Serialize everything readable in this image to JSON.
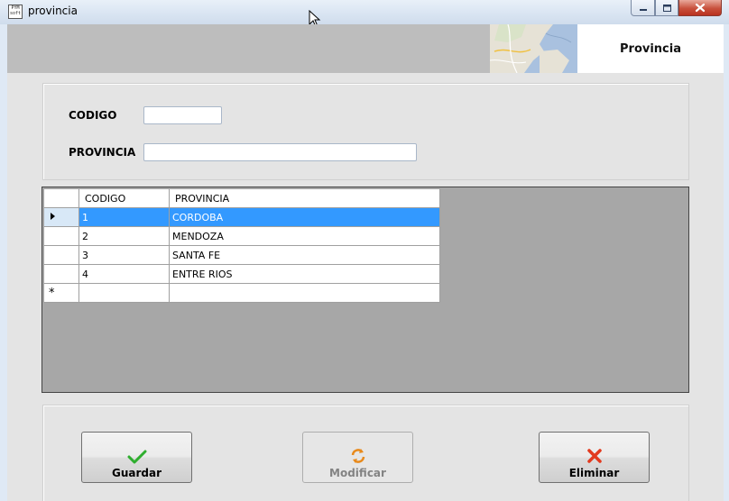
{
  "window": {
    "title": "provincia",
    "app_icon": "app-icon",
    "app_icon_text": "PYM soft",
    "controls": [
      "minimize-icon",
      "maximize-icon",
      "close-icon"
    ]
  },
  "header": {
    "title": "Provincia",
    "image": "map-image"
  },
  "form": {
    "codigo_label": "CODIGO",
    "codigo_value": "",
    "provincia_label": "PROVINCIA",
    "provincia_value": ""
  },
  "grid": {
    "columns": [
      "CODIGO",
      "PROVINCIA"
    ],
    "rows": [
      {
        "codigo": "1",
        "provincia": "CORDOBA",
        "selected": true
      },
      {
        "codigo": "2",
        "provincia": "MENDOZA",
        "selected": false
      },
      {
        "codigo": "3",
        "provincia": "SANTA FE",
        "selected": false
      },
      {
        "codigo": "4",
        "provincia": "ENTRE RIOS",
        "selected": false
      }
    ],
    "new_row_marker": "*",
    "selection_color": "#3399ff"
  },
  "buttons": {
    "guardar": {
      "label": "Guardar",
      "icon": "checkmark-icon",
      "enabled": true
    },
    "modificar": {
      "label": "Modificar",
      "icon": "refresh-icon",
      "enabled": false
    },
    "eliminar": {
      "label": "Eliminar",
      "icon": "delete-x-icon",
      "enabled": true
    }
  }
}
